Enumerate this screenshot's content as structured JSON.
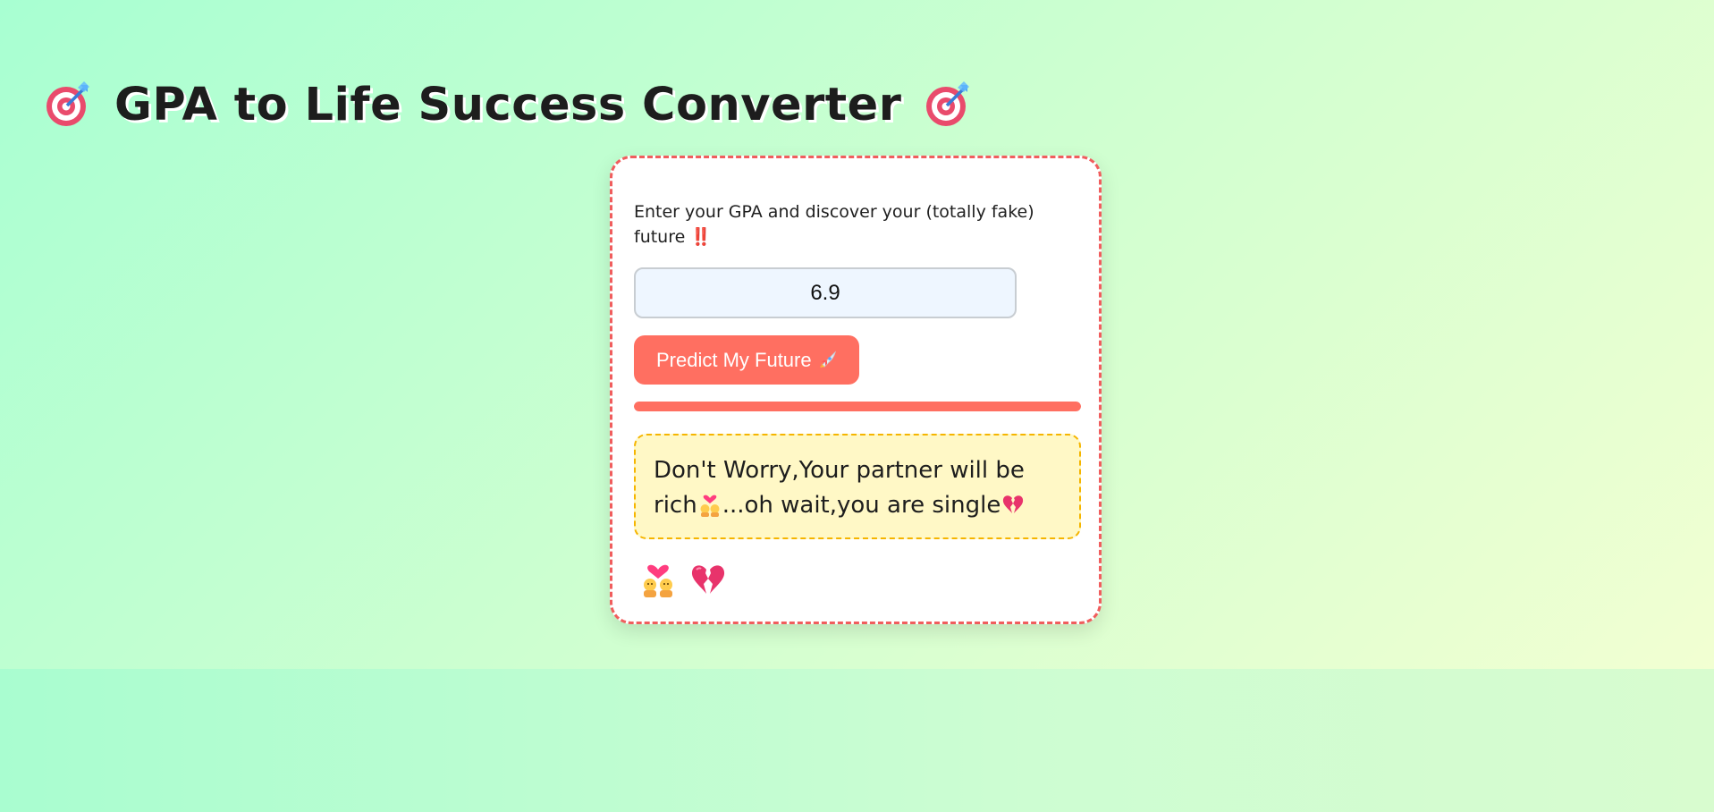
{
  "header": {
    "title": "GPA to Life Success Converter",
    "left_icon": "target-icon",
    "right_icon": "target-icon"
  },
  "form": {
    "prompt": "Enter your GPA and discover your (totally fake) future ‼️",
    "gpa_value": "6.9",
    "button_label": "Predict My Future",
    "button_icon": "rocket-icon"
  },
  "progress": {
    "percent": 100
  },
  "result": {
    "text_part1": "Don't Worry,Your partner will be rich",
    "text_part2": "...oh wait,you are single",
    "icons": [
      "couple-with-heart-icon",
      "broken-heart-icon"
    ]
  },
  "reactions": [
    "couple-with-heart-icon",
    "broken-heart-icon"
  ],
  "colors": {
    "accent": "#ff6f61",
    "card_border": "#f05d5d",
    "result_bg": "#fff8c6",
    "result_border": "#f5b500",
    "input_bg": "#eef6ff"
  }
}
